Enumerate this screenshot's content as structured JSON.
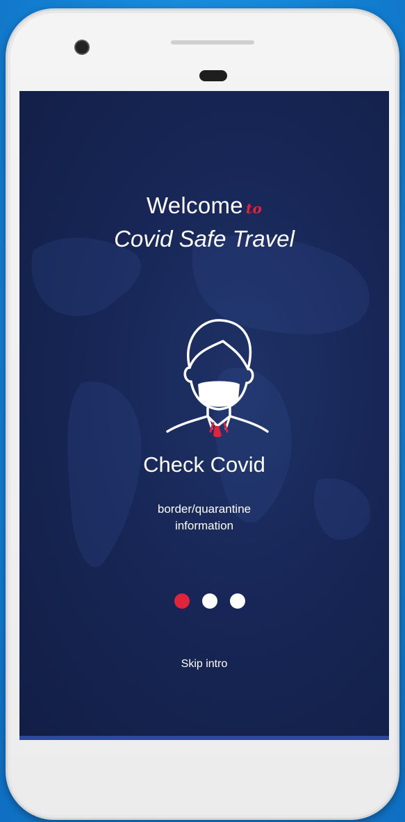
{
  "welcome": {
    "line1": "Welcome",
    "connector": "to",
    "app_name": "Covid Safe Travel"
  },
  "intro_slide": {
    "icon": "masked-person-icon",
    "heading": "Check Covid",
    "description_line1": "border/quarantine",
    "description_line2": "information"
  },
  "pagination": {
    "total": 3,
    "active_index": 0
  },
  "skip": {
    "label": "Skip intro"
  },
  "colors": {
    "background": "#172656",
    "accent": "#e0243b",
    "text": "#ffffff"
  }
}
